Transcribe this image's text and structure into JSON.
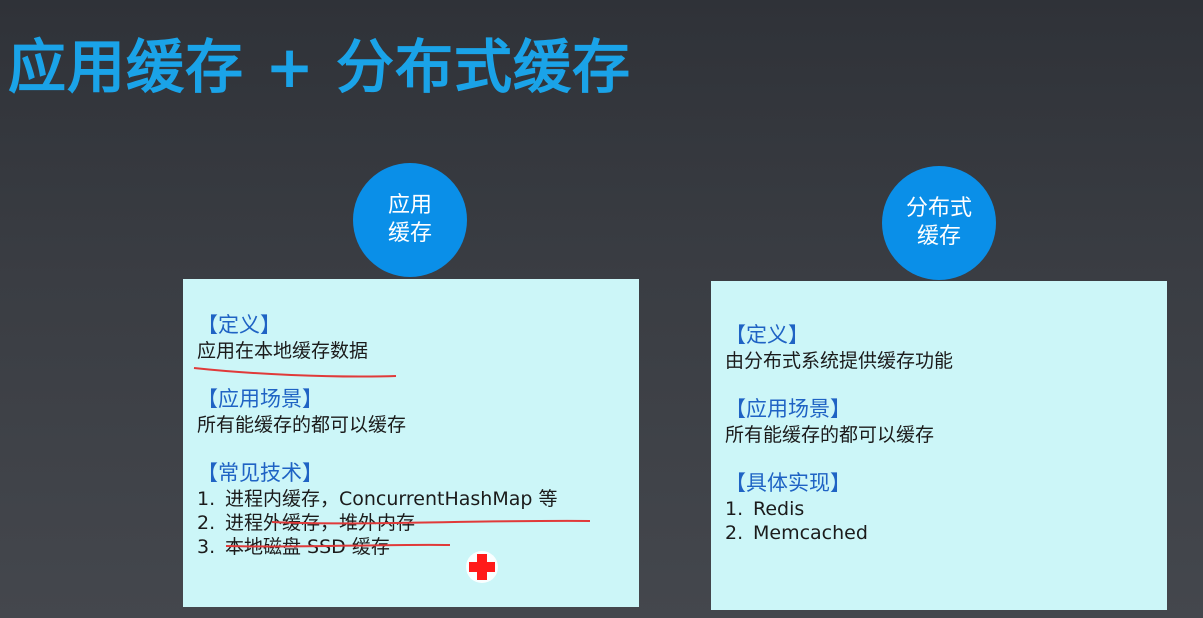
{
  "slide": {
    "title": "应用缓存 + 分布式缓存"
  },
  "left": {
    "circle_label": "应用\n缓存",
    "definition_heading": "【定义】",
    "definition_text": "应用在本地缓存数据",
    "scenario_heading": "【应用场景】",
    "scenario_text": "所有能缓存的都可以缓存",
    "tech_heading": "【常见技术】",
    "tech_items": [
      {
        "num": "1.",
        "text": "进程内缓存，ConcurrentHashMap 等"
      },
      {
        "num": "2.",
        "text": "进程外缓存，堆外内存"
      },
      {
        "num": "3.",
        "text": "本地磁盘 SSD 缓存"
      }
    ]
  },
  "right": {
    "circle_label": "分布式\n缓存",
    "definition_heading": "【定义】",
    "definition_text": "由分布式系统提供缓存功能",
    "scenario_heading": "【应用场景】",
    "scenario_text": "所有能缓存的都可以缓存",
    "impl_heading": "【具体实现】",
    "impl_items": [
      {
        "num": "1.",
        "text": "Redis"
      },
      {
        "num": "2.",
        "text": "Memcached"
      }
    ]
  },
  "colors": {
    "title": "#1aa3e8",
    "circle": "#0a8fe8",
    "card_bg": "#ccf6f8",
    "section_heading": "#1f63c4",
    "underline": "#e03a3a",
    "cursor_cross": "#ff1a1a"
  }
}
